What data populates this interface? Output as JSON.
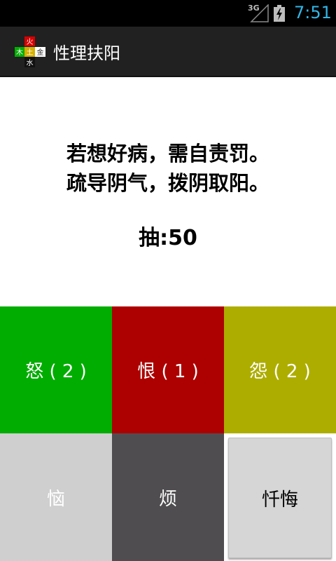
{
  "status_bar": {
    "network": "3G",
    "time": "7:51",
    "signal_icon": "signal-icon",
    "battery_icon": "battery-charging-icon"
  },
  "action_bar": {
    "title": "性理扶阳",
    "logo": {
      "icon": "five-elements-logo",
      "top": "火",
      "left": "木",
      "center": "土",
      "right": "金",
      "bottom": "水"
    }
  },
  "message": {
    "line1": "若想好病，需自责罚。",
    "line2": "疏导阴气，拨阴取阳。",
    "draw": "抽:50"
  },
  "buttons": {
    "anger": "怒 ( 2 )",
    "hate": "恨 ( 1 )",
    "resent": "怨 ( 2 )",
    "annoy": "恼",
    "vex": "烦",
    "repent": "忏悔"
  },
  "colors": {
    "anger": "#00ad00",
    "hate": "#ad0000",
    "resent": "#adad00",
    "annoy": "#cfcfcf",
    "vex": "#4f4d50",
    "repent": "#d6d6d6",
    "time": "#33b5e5"
  }
}
